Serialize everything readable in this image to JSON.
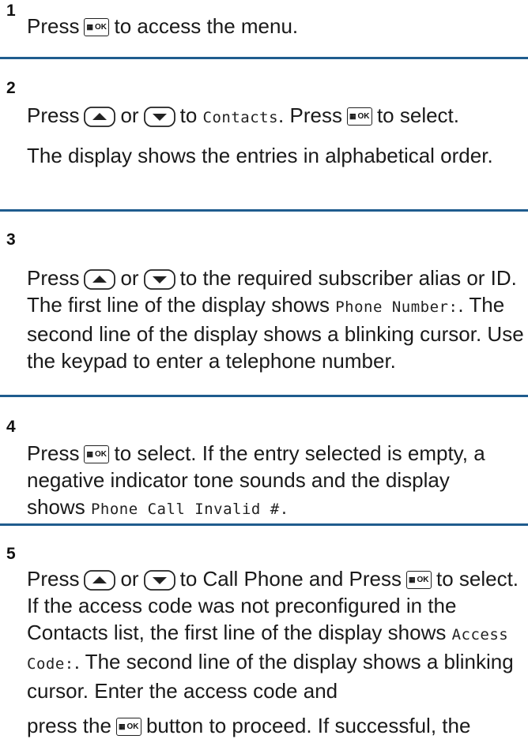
{
  "icons": {
    "ok_key": "menu-ok-key-icon",
    "up_key": "up-arrow-key-icon",
    "down_key": "down-arrow-key-icon"
  },
  "ok_key_label": "OK",
  "steps": [
    {
      "number": "1",
      "t1": "Press",
      "t2": "to access the menu."
    },
    {
      "number": "2",
      "t1": "Press",
      "t2": "or",
      "t3": "to",
      "contacts": "Contacts",
      "t4": ". Press",
      "t5": "to select.",
      "note": "The display shows the entries in alphabetical order."
    },
    {
      "number": "3",
      "t1": "Press",
      "t2": "or",
      "t3": "to the required subscriber alias or ID. The first line of the display shows",
      "phone_number": "Phone Number:",
      "t4": ". The second line of the display shows a blinking cursor. Use the keypad to enter a telephone number."
    },
    {
      "number": "4",
      "t1": "Press",
      "t2": "to select. If the entry selected is empty, a negative indicator tone sounds and the display shows",
      "invalid": "Phone Call Invalid #."
    },
    {
      "number": "5",
      "t1": "Press",
      "t2": "or",
      "t3": "to Call Phone and Press",
      "t4": "to select. If the access code was not preconfigured in the Contacts list, the first line of the display shows",
      "access_code": "Access Code:",
      "t5": ". The second line of the display shows a blinking cursor. Enter the access code and",
      "t6": "press the",
      "t7": "button to proceed. If successful, the"
    }
  ]
}
